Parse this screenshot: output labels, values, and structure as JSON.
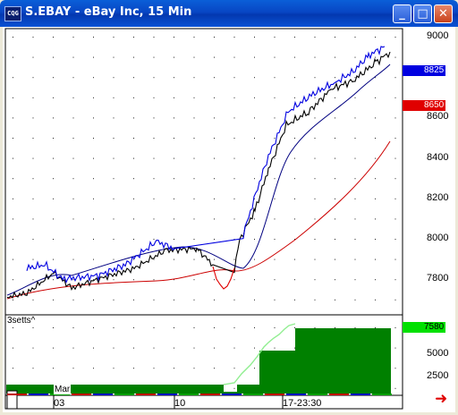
{
  "window": {
    "title": "S.EBAY - eBay Inc, 15 Min",
    "icon": "CQG",
    "minimize_glyph": "_",
    "maximize_glyph": "□",
    "close_glyph": "✕"
  },
  "price_panel": {
    "y_ticks": [
      "9000",
      "8600",
      "8400",
      "8200",
      "8000",
      "7800"
    ],
    "last_price_tag": "8825",
    "ma_tag": "8650",
    "colors": {
      "up": "#0000e0",
      "down": "#e00000",
      "neutral": "#000000",
      "long_ma": "#cc0000",
      "short_ma": "#000080"
    }
  },
  "indicator_panel": {
    "name": "3setts^",
    "y_ticks": [
      "5000",
      "2500"
    ],
    "value_tag": "7580",
    "fill_color": "#008000",
    "line_color": "#90ee90"
  },
  "time_axis": {
    "labels": [
      "Mar",
      "03",
      "10",
      "17-23:30"
    ]
  },
  "scroll_arrow": "➜"
}
